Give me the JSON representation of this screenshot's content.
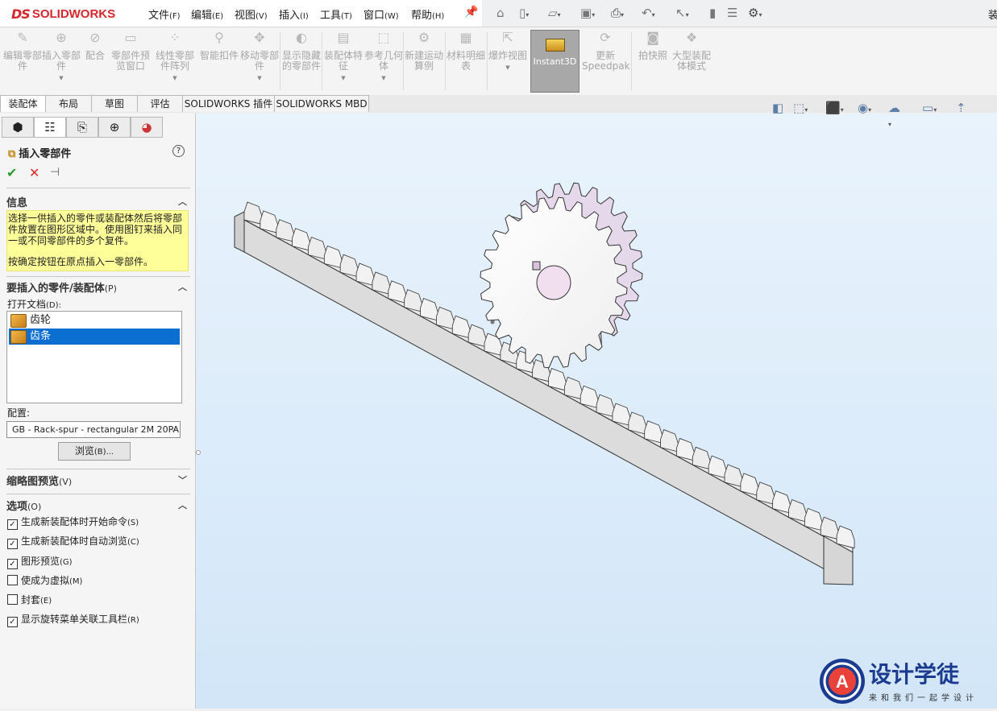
{
  "menubar": {
    "logo_ds": "DS",
    "logo_text": "SOLIDWORKS",
    "items": [
      {
        "label": "文件",
        "key": "(F)"
      },
      {
        "label": "编辑",
        "key": "(E)"
      },
      {
        "label": "视图",
        "key": "(V)"
      },
      {
        "label": "插入",
        "key": "(I)"
      },
      {
        "label": "工具",
        "key": "(T)"
      },
      {
        "label": "窗口",
        "key": "(W)"
      },
      {
        "label": "帮助",
        "key": "(H)"
      }
    ],
    "right_text": "装"
  },
  "quickbar_icons": [
    "home-icon",
    "new-icon",
    "open-icon",
    "save-icon",
    "print-icon",
    "undo-icon",
    "select-icon",
    "rebuild-icon",
    "file-properties-icon",
    "options-icon"
  ],
  "commandmanager": {
    "items": [
      {
        "label": "编辑零部件"
      },
      {
        "label": "插入零部件"
      },
      {
        "label": "配合"
      },
      {
        "label": "零部件预览窗口"
      },
      {
        "label": "线性零部件阵列"
      },
      {
        "label": "智能扣件"
      },
      {
        "label": "移动零部件"
      },
      {
        "label": "显示隐藏的零部件"
      },
      {
        "label": "装配体特征"
      },
      {
        "label": "参考几何体"
      },
      {
        "label": "新建运动算例"
      },
      {
        "label": "材料明细表"
      },
      {
        "label": "爆炸视图"
      },
      {
        "label": "Instant3D"
      },
      {
        "label": "更新Speedpak"
      },
      {
        "label": "拍快照"
      },
      {
        "label": "大型装配体模式"
      }
    ]
  },
  "tabs": [
    "装配体",
    "布局",
    "草图",
    "评估",
    "SOLIDWORKS 插件",
    "SOLIDWORKS MBD"
  ],
  "pm": {
    "title": "插入零部件",
    "help": "?",
    "info_header": "信息",
    "info_text_1": "选择一供插入的零件或装配体然后将零部件放置在图形区域中。使用图钉来插入同一或不同零部件的多个复件。",
    "info_text_2": "按确定按钮在原点插入一零部件。",
    "parts_header": "要插入的零件/装配体",
    "parts_key": "(P)",
    "open_docs_label": "打开文档",
    "open_docs_key": "(D):",
    "docs": [
      {
        "name": "齿轮",
        "selected": false
      },
      {
        "name": "齿条",
        "selected": true
      }
    ],
    "config_label": "配置:",
    "config_value": "GB - Rack-spur - rectangular 2M 20PA",
    "browse": "浏览",
    "browse_key": "(B)...",
    "thumb_header": "缩略图预览",
    "thumb_key": "(V)",
    "options_header": "选项",
    "options_key": "(O)",
    "options": [
      {
        "label": "生成新装配体时开始命令",
        "key": "(S)",
        "checked": true
      },
      {
        "label": "生成新装配体时自动浏览",
        "key": "(C)",
        "checked": true
      },
      {
        "label": "图形预览",
        "key": "(G)",
        "checked": true
      },
      {
        "label": "使成为虚拟",
        "key": "(M)",
        "checked": false
      },
      {
        "label": "封套",
        "key": "(E)",
        "checked": false
      },
      {
        "label": "显示旋转菜单关联工具栏",
        "key": "(R)",
        "checked": true
      }
    ]
  },
  "watermark": {
    "title": "设计学徒",
    "subtitle": "来和我们一起学设计"
  },
  "colors": {
    "accent": "#d8262d",
    "selection": "#0a6fd0",
    "info_bg": "#ffff99"
  }
}
